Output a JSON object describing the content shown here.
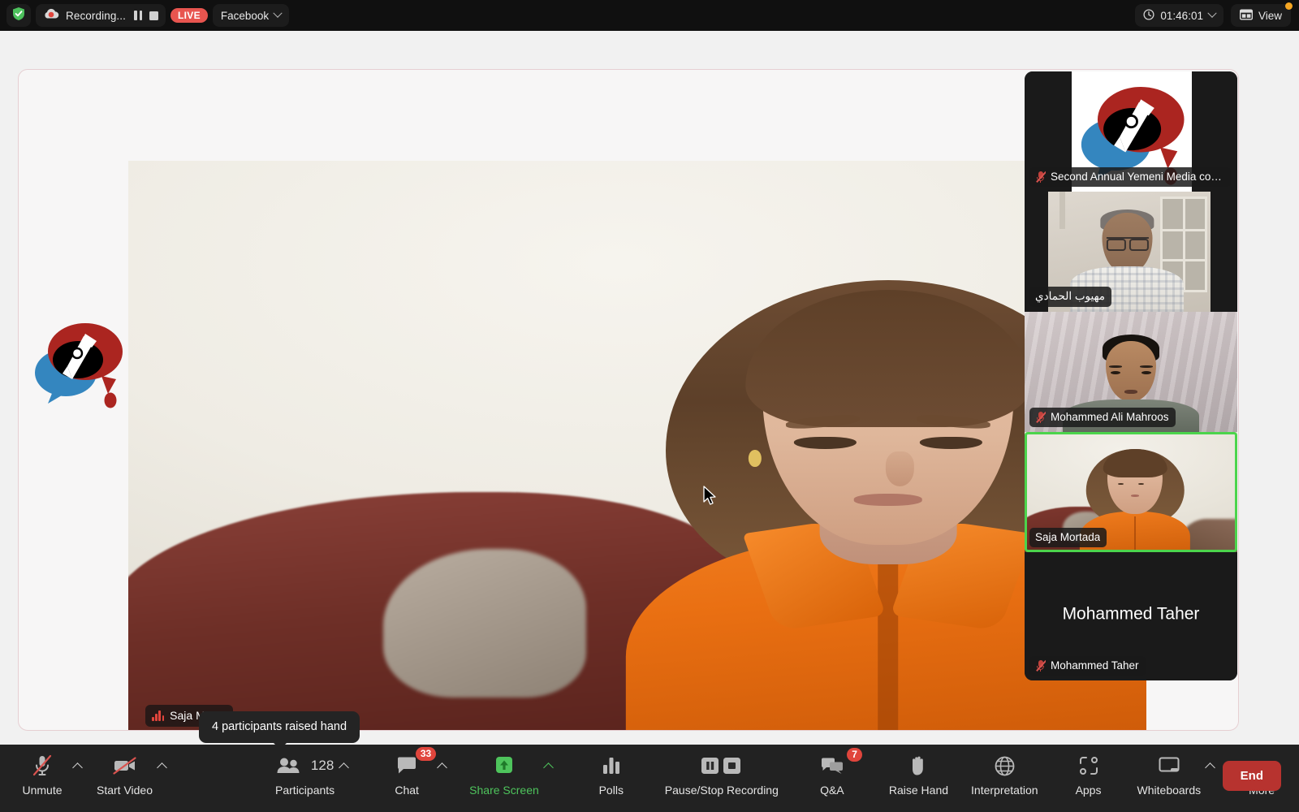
{
  "topbar": {
    "security_icon": "shield-check-icon",
    "recording_icon": "cloud-record-icon",
    "recording_label": "Recording...",
    "pause_recording_icon": "pause-icon",
    "stop_recording_icon": "stop-icon",
    "live_badge": "LIVE",
    "live_platform": "Facebook",
    "platform_caret_icon": "chevron-down-icon",
    "timer_icon": "clock-icon",
    "timer": "01:46:01",
    "timer_caret_icon": "chevron-down-icon",
    "view_icon": "grid-view-icon",
    "view_label": "View",
    "view_notification_dot": "#f5a623"
  },
  "stage": {
    "branding_logo": "yemeni-media-conference-logo",
    "main_speaker_name": "Saja Morta",
    "main_speaker_audio_icon": "audio-level-bars-icon",
    "tooltip": "4 participants raised hand"
  },
  "filmstrip": {
    "tiles": [
      {
        "name": "Second Annual Yemeni Media confe...",
        "muted": true,
        "active": false,
        "has_video": true,
        "kind": "logo-slide"
      },
      {
        "name": "مهيوب الحمادي",
        "muted": false,
        "active": false,
        "has_video": true,
        "kind": "person"
      },
      {
        "name": "Mohammed Ali Mahroos",
        "muted": true,
        "active": false,
        "has_video": true,
        "kind": "person"
      },
      {
        "name": "Saja Mortada",
        "muted": false,
        "active": true,
        "has_video": true,
        "kind": "person"
      },
      {
        "name": "Mohammed Taher",
        "muted": true,
        "active": false,
        "has_video": false,
        "kind": "avatar",
        "avatar_text": "Mohammed Taher"
      }
    ],
    "active_border_color": "#4cd44c"
  },
  "toolbar": {
    "items": [
      {
        "label": "Unmute",
        "icon": "microphone-muted-icon",
        "caret": true,
        "badge": null,
        "green": false
      },
      {
        "label": "Start Video",
        "icon": "camera-off-icon",
        "caret": true,
        "badge": null,
        "green": false
      },
      {
        "label": "Participants",
        "icon": "participants-icon",
        "caret": true,
        "badge": null,
        "green": false,
        "count": "128"
      },
      {
        "label": "Chat",
        "icon": "chat-bubble-icon",
        "caret": true,
        "badge": "33",
        "green": false
      },
      {
        "label": "Share Screen",
        "icon": "share-screen-icon",
        "caret": true,
        "badge": null,
        "green": true
      },
      {
        "label": "Polls",
        "icon": "polls-bar-icon",
        "caret": false,
        "badge": null,
        "green": false
      },
      {
        "label": "Pause/Stop Recording",
        "icon": "pause-stop-recording-icon",
        "caret": false,
        "badge": null,
        "green": false
      },
      {
        "label": "Q&A",
        "icon": "qa-bubbles-icon",
        "caret": false,
        "badge": "7",
        "green": false
      },
      {
        "label": "Raise Hand",
        "icon": "raise-hand-icon",
        "caret": false,
        "badge": null,
        "green": false
      },
      {
        "label": "Interpretation",
        "icon": "globe-icon",
        "caret": false,
        "badge": null,
        "green": false
      },
      {
        "label": "Apps",
        "icon": "apps-icon",
        "caret": false,
        "badge": null,
        "green": false
      },
      {
        "label": "Whiteboards",
        "icon": "whiteboard-icon",
        "caret": true,
        "badge": null,
        "green": false
      },
      {
        "label": "More",
        "icon": "more-dots-icon",
        "caret": false,
        "badge": null,
        "green": false
      }
    ],
    "end_label": "End",
    "end_color": "#b7332f"
  }
}
